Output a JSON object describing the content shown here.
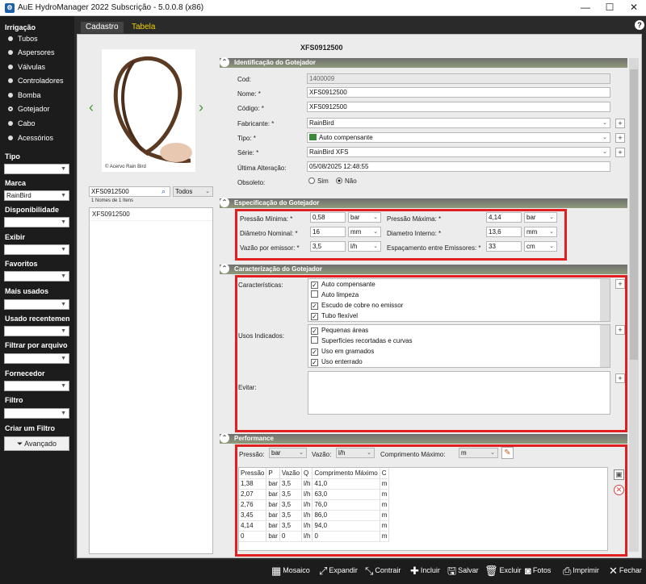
{
  "window": {
    "title": "AuE HydroManager 2022 Subscrição - 5.0.0.8 (x86)",
    "minimize": "—",
    "maximize": "☐",
    "close": "✕"
  },
  "sidebar": {
    "irrigacao_title": "Irrigação",
    "items": [
      {
        "label": "Tubos"
      },
      {
        "label": "Aspersores"
      },
      {
        "label": "Válvulas"
      },
      {
        "label": "Controladores"
      },
      {
        "label": "Bomba"
      },
      {
        "label": "Gotejador"
      },
      {
        "label": "Cabo"
      },
      {
        "label": "Acessórios"
      }
    ],
    "tipo": {
      "label": "Tipo",
      "value": ""
    },
    "marca": {
      "label": "Marca",
      "value": "RainBird"
    },
    "disponibilidade": {
      "label": "Disponibilidade",
      "value": ""
    },
    "exibir": {
      "label": "Exibir",
      "value": ""
    },
    "favoritos": {
      "label": "Favoritos",
      "value": ""
    },
    "mais_usados": {
      "label": "Mais usados",
      "value": ""
    },
    "usado_recentemente": {
      "label": "Usado recentement",
      "value": ""
    },
    "filtrar_arquivo": {
      "label": "Filtrar por arquivo I",
      "value": ""
    },
    "fornecedor": {
      "label": "Fornecedor",
      "value": ""
    },
    "filtro": {
      "label": "Filtro",
      "value": ""
    },
    "criar_filtro": "Criar um Filtro",
    "avancado": "Avançado"
  },
  "tabs": {
    "cadastro": "Cadastro",
    "tabela": "Tabela",
    "help": "?"
  },
  "product": {
    "title": "XFS0912500",
    "photo_caption": "© Acervo Rain Bird"
  },
  "search": {
    "value": "XFS0912500",
    "filter": "Todos",
    "count_text": "1 Nomes de 1 Itens",
    "results": [
      "XFS0912500"
    ]
  },
  "identificacao": {
    "title": "Identificação do Gotejador",
    "cod_label": "Cod:",
    "cod": "1400009",
    "nome_label": "Nome: *",
    "nome": "XFS0912500",
    "codigo_label": "Código: *",
    "codigo": "XFS0912500",
    "fabricante_label": "Fabricante: *",
    "fabricante": "RainBird",
    "tipo_label": "Tipo: *",
    "tipo": "Auto compensante",
    "serie_label": "Série: *",
    "serie": "RainBird XFS",
    "alteracao_label": "Última Alteração:",
    "alteracao": "05/08/2025 12:48:55",
    "obsoleto_label": "Obsoleto:",
    "sim": "Sim",
    "nao": "Não"
  },
  "especificacao": {
    "title": "Especificação do Gotejador",
    "pmin_label": "Pressão Mínima: *",
    "pmin": "0,58",
    "pmin_unit": "bar",
    "pmax_label": "Pressão Máxima: *",
    "pmax": "4,14",
    "pmax_unit": "bar",
    "dnom_label": "Diâmetro Nominal: *",
    "dnom": "16",
    "dnom_unit": "mm",
    "dint_label": "Diametro Interno: *",
    "dint": "13,6",
    "dint_unit": "mm",
    "vazao_label": "Vazão por emissor: *",
    "vazao": "3,5",
    "vazao_unit": "l/h",
    "esp_label": "Espaçamento entre Emissores: *",
    "esp": "33",
    "esp_unit": "cm"
  },
  "caracterizacao": {
    "title": "Caracterização do Gotejador",
    "caract_label": "Características:",
    "caracteristicas": [
      {
        "label": "Auto compensante",
        "checked": "✓"
      },
      {
        "label": "Auto limpeza",
        "checked": ""
      },
      {
        "label": "Escudo de cobre no emissor",
        "checked": "✓"
      },
      {
        "label": "Tubo flexível",
        "checked": "✓"
      }
    ],
    "usos_label": "Usos Indicados:",
    "usos": [
      {
        "label": "Pequenas áreas",
        "checked": "✓"
      },
      {
        "label": "Superfícies recortadas e curvas",
        "checked": ""
      },
      {
        "label": "Uso em gramados",
        "checked": "✓"
      },
      {
        "label": "Uso enterrado",
        "checked": "✓"
      }
    ],
    "evitar_label": "Evitar:"
  },
  "performance": {
    "title": "Performance",
    "pressao_label": "Pressão:",
    "pressao": "bar",
    "vazao_label": "Vazão:",
    "vazao": "l/h",
    "comp_label": "Comprimento Máximo:",
    "comp": "m",
    "headers": [
      "Pressão",
      "P",
      "Vazão",
      "Q",
      "Comprimento Máximo",
      "C"
    ],
    "rows": [
      [
        "1,38",
        "bar",
        "3,5",
        "l/h",
        "41,0",
        "m"
      ],
      [
        "2,07",
        "bar",
        "3,5",
        "l/h",
        "63,0",
        "m"
      ],
      [
        "2,76",
        "bar",
        "3,5",
        "l/h",
        "76,0",
        "m"
      ],
      [
        "3,45",
        "bar",
        "3,5",
        "l/h",
        "86,0",
        "m"
      ],
      [
        "4,14",
        "bar",
        "3,5",
        "l/h",
        "94,0",
        "m"
      ],
      [
        "0",
        "bar",
        "0",
        "l/h",
        "0",
        "m"
      ]
    ]
  },
  "toolbar": {
    "mosaico": "Mosaico",
    "expandir": "Expandir",
    "contrair": "Contrair",
    "incluir": "Incluir",
    "salvar": "Salvar",
    "excluir": "Excluir",
    "fotos": "Fotos",
    "imprimir": "Imprimir",
    "fechar": "Fechar"
  },
  "colors": {
    "highlight": "#e02020",
    "tab_active": "#f0d000",
    "section": "#7a8066"
  }
}
